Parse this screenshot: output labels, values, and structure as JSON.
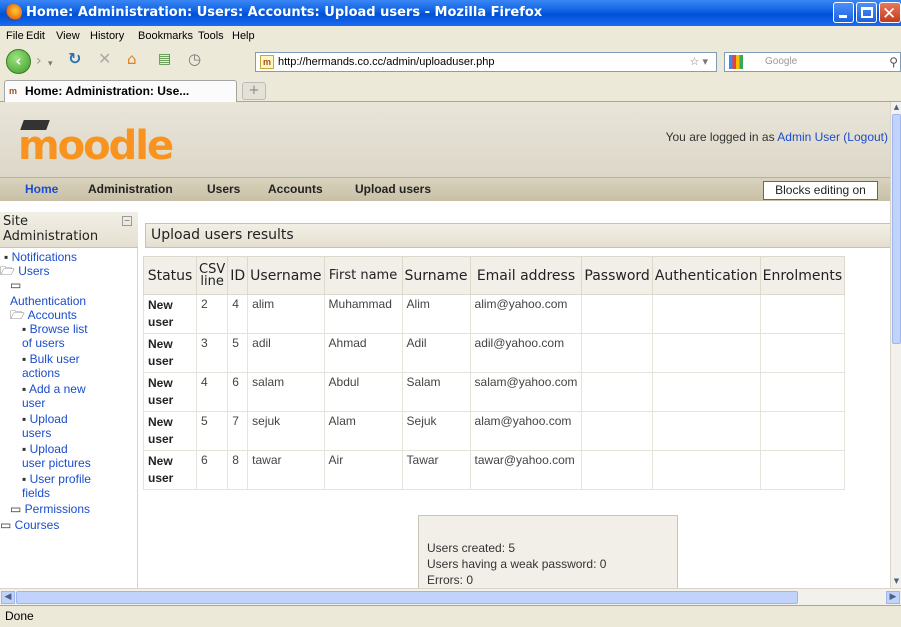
{
  "window": {
    "title": "Home: Administration: Users: Accounts: Upload users - Mozilla Firefox"
  },
  "menu": [
    "File",
    "Edit",
    "View",
    "History",
    "Bookmarks",
    "Tools",
    "Help"
  ],
  "nav": {
    "url": "http://hermands.co.cc/admin/uploaduser.php",
    "search_placeholder": "Google"
  },
  "tab": {
    "title": "Home: Administration: Use...",
    "favicon": "m"
  },
  "header": {
    "logo": "moodle",
    "login_prefix": "You are logged in as ",
    "login_user": "Admin User",
    "logout": "(Logout)"
  },
  "breadcrumb": [
    "Home",
    "Administration",
    "Users",
    "Accounts",
    "Upload users"
  ],
  "blocks_button": "Blocks editing on",
  "sidebar": {
    "title_line1": "Site",
    "title_line2": "Administration",
    "notifications": "Notifications",
    "users": "Users",
    "authentication": "Authentication",
    "accounts": "Accounts",
    "browse_1": "Browse list",
    "browse_2": "of users",
    "bulk_1": "Bulk user",
    "bulk_2": "actions",
    "add_1": "Add a new",
    "add_2": "user",
    "upload_1": "Upload",
    "upload_2": "users",
    "pictures_1": "Upload",
    "pictures_2": "user pictures",
    "profile_1": "User profile",
    "profile_2": "fields",
    "permissions": "Permissions",
    "courses": "Courses"
  },
  "main": {
    "title": "Upload users results",
    "columns": [
      "Status",
      "CSV line",
      "ID",
      "Username",
      "First name",
      "Surname",
      "Email address",
      "Password",
      "Authentication",
      "Enrolments"
    ],
    "rows": [
      {
        "status": "New user",
        "line": "2",
        "id": "4",
        "username": "alim",
        "first": "Muhammad",
        "surname": "Alim",
        "email": "alim@yahoo.com"
      },
      {
        "status": "New user",
        "line": "3",
        "id": "5",
        "username": "adil",
        "first": "Ahmad",
        "surname": "Adil",
        "email": "adil@yahoo.com"
      },
      {
        "status": "New user",
        "line": "4",
        "id": "6",
        "username": "salam",
        "first": "Abdul",
        "surname": "Salam",
        "email": "salam@yahoo.com"
      },
      {
        "status": "New user",
        "line": "5",
        "id": "7",
        "username": "sejuk",
        "first": "Alam",
        "surname": "Sejuk",
        "email": "alam@yahoo.com"
      },
      {
        "status": "New user",
        "line": "6",
        "id": "8",
        "username": "tawar",
        "first": "Air",
        "surname": "Tawar",
        "email": "tawar@yahoo.com"
      }
    ],
    "summary": {
      "created": "Users created: 5",
      "weak": "Users having a weak password: 0",
      "errors": "Errors: 0"
    }
  },
  "status_bar": "Done"
}
